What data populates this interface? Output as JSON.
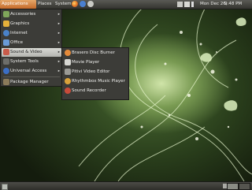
{
  "top_panel": {
    "applications_label": "Applications",
    "places_label": "Places",
    "system_label": "System",
    "launchers": [
      "firefox-icon",
      "help-icon",
      "mail-icon"
    ],
    "tray_icons": [
      "network-icon",
      "mail-icon",
      "volume-icon"
    ],
    "date": "Mon Dec 26,",
    "time": "9:48 PM",
    "accent_color": "#d77a3a"
  },
  "menu": {
    "items": [
      {
        "label": "Accessories",
        "icon": "accessories-icon",
        "color": "#7fa55a",
        "has_submenu": true
      },
      {
        "label": "Graphics",
        "icon": "graphics-icon",
        "color": "#e5b13a",
        "has_submenu": true
      },
      {
        "label": "Internet",
        "icon": "internet-icon",
        "color": "#4a82c8",
        "has_submenu": true
      },
      {
        "label": "Office",
        "icon": "office-icon",
        "color": "#6a9ad6",
        "has_submenu": true
      },
      {
        "label": "Sound & Video",
        "icon": "sound-video-icon",
        "color": "#c95c4b",
        "has_submenu": true,
        "active": true
      },
      {
        "label": "System Tools",
        "icon": "system-tools-icon",
        "color": "#6e6e6a",
        "has_submenu": true
      },
      {
        "label": "Universal Access",
        "icon": "universal-access-icon",
        "color": "#3b6ec5",
        "has_submenu": true
      },
      {
        "label": "Package Manager",
        "icon": "package-manager-icon",
        "color": "#8a7a5a",
        "has_submenu": false
      }
    ]
  },
  "submenu": {
    "items": [
      {
        "label": "Brasero Disc Burner",
        "icon": "brasero-icon",
        "color": "#e48a3a"
      },
      {
        "label": "Movie Player",
        "icon": "movie-player-icon",
        "color": "#d7d7d2"
      },
      {
        "label": "Pitivi Video Editor",
        "icon": "pitivi-icon",
        "color": "#9a9a95"
      },
      {
        "label": "Rhythmbox Music Player",
        "icon": "rhythmbox-icon",
        "color": "#d9a23a"
      },
      {
        "label": "Sound Recorder",
        "icon": "sound-recorder-icon",
        "color": "#c84b3a"
      }
    ]
  },
  "bottom_panel": {
    "show_desktop_icon": "show-desktop-icon",
    "trash_icon": "trash-icon",
    "workspaces": [
      {
        "active": true
      },
      {
        "active": false
      }
    ]
  }
}
